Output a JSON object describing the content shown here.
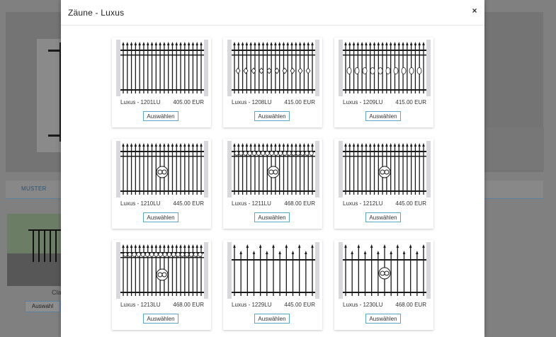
{
  "background": {
    "tab_label": "MUSTER",
    "caption": "Cla",
    "button_label": "Auswahl"
  },
  "modal": {
    "title": "Zäune - Luxus",
    "close_symbol": "×",
    "products": [
      {
        "name": "Luxus - 1201LU",
        "price": "405.00 EUR",
        "button": "Auswählen",
        "style": "plain"
      },
      {
        "name": "Luxus - 1208LU",
        "price": "415.00 EUR",
        "button": "Auswählen",
        "style": "diamonds"
      },
      {
        "name": "Luxus - 1209LU",
        "price": "415.00 EUR",
        "button": "Auswählen",
        "style": "ovals"
      },
      {
        "name": "Luxus - 1210LU",
        "price": "445.00 EUR",
        "button": "Auswählen",
        "style": "ornament"
      },
      {
        "name": "Luxus - 1211LU",
        "price": "468.00 EUR",
        "button": "Auswählen",
        "style": "ornament-rings"
      },
      {
        "name": "Luxus - 1212LU",
        "price": "445.00 EUR",
        "button": "Auswählen",
        "style": "ornament-alt"
      },
      {
        "name": "Luxus - 1213LU",
        "price": "468.00 EUR",
        "button": "Auswählen",
        "style": "ornament-rings-low"
      },
      {
        "name": "Luxus - 1229LU",
        "price": "445.00 EUR",
        "button": "Auswählen",
        "style": "tall-spears"
      },
      {
        "name": "Luxus - 1230LU",
        "price": "468.00 EUR",
        "button": "Auswählen",
        "style": "tall-ornament"
      }
    ]
  },
  "colors": {
    "button_border": "#5aa7c9",
    "fence_dark": "#1a1a1a",
    "post": "#d9d9dd"
  }
}
